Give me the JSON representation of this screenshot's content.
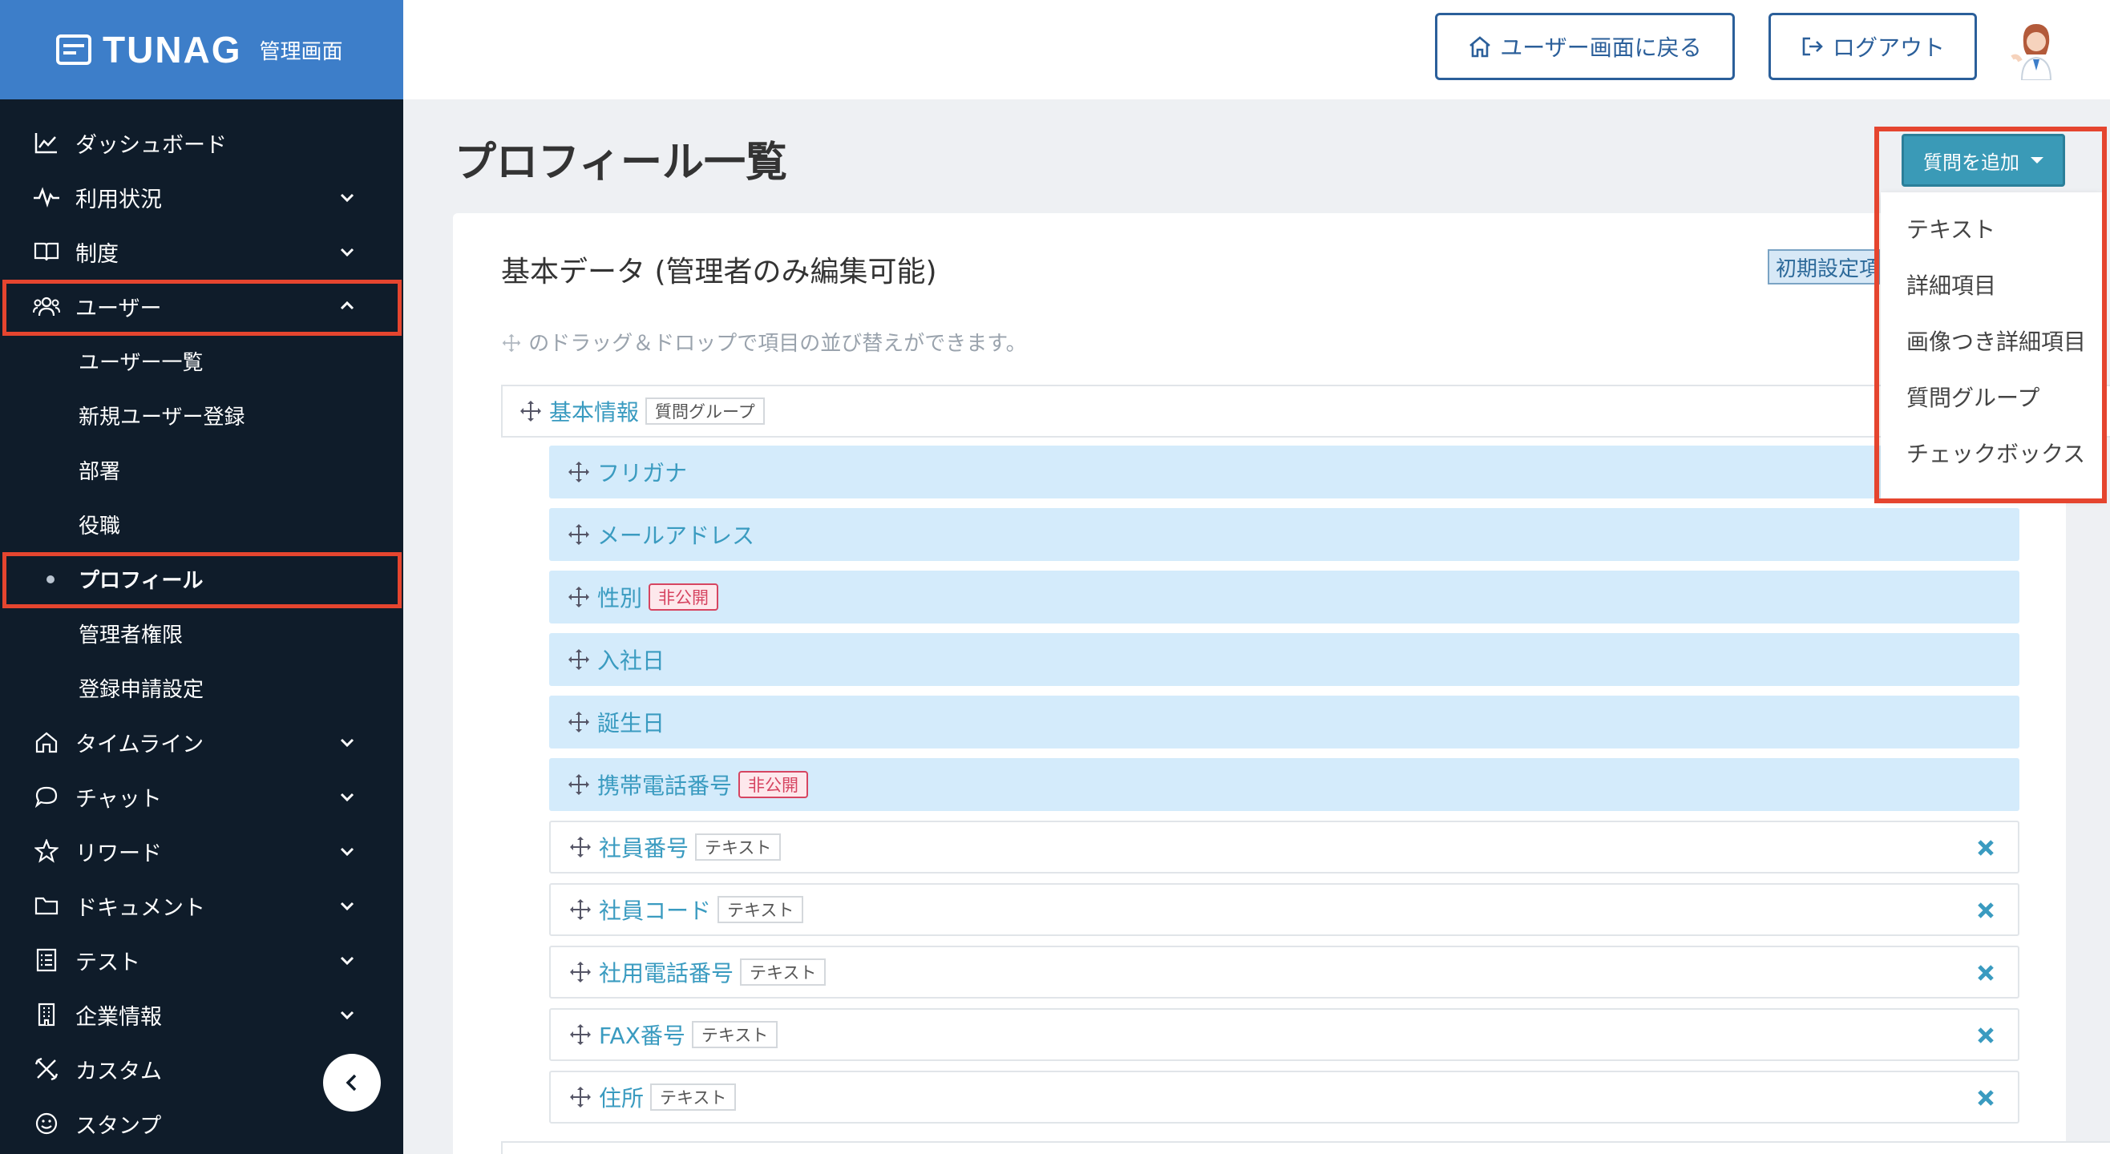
{
  "brand": {
    "logo": "TUNAG",
    "subtitle": "管理画面"
  },
  "sidebar": {
    "items": [
      {
        "label": "ダッシュボード",
        "icon": "chart-icon"
      },
      {
        "label": "利用状況",
        "icon": "pulse-icon"
      },
      {
        "label": "制度",
        "icon": "book-icon"
      },
      {
        "label": "ユーザー",
        "icon": "users-icon"
      },
      {
        "label": "タイムライン",
        "icon": "home-icon"
      },
      {
        "label": "チャット",
        "icon": "chat-icon"
      },
      {
        "label": "リワード",
        "icon": "star-icon"
      },
      {
        "label": "ドキュメント",
        "icon": "folder-icon"
      },
      {
        "label": "テスト",
        "icon": "checklist-icon"
      },
      {
        "label": "企業情報",
        "icon": "building-icon"
      },
      {
        "label": "カスタム",
        "icon": "tools-icon"
      },
      {
        "label": "スタンプ",
        "icon": "smile-icon"
      }
    ],
    "sub_items": [
      {
        "label": "ユーザー一覧"
      },
      {
        "label": "新規ユーザー登録"
      },
      {
        "label": "部署"
      },
      {
        "label": "役職"
      },
      {
        "label": "プロフィール"
      },
      {
        "label": "管理者権限"
      },
      {
        "label": "登録申請設定"
      }
    ]
  },
  "header": {
    "back_label": "ユーザー画面に戻る",
    "logout_label": "ログアウト"
  },
  "page": {
    "title": "プロフィール一覧",
    "card_title": "基本データ (管理者のみ編集可能)",
    "init_badge": "初期設定項目",
    "hint": "のドラッグ＆ドロップで項目の並び替えができます。"
  },
  "group": {
    "label": "基本情報",
    "tag": "質問グループ"
  },
  "items": [
    {
      "label": "フリガナ",
      "tag": ""
    },
    {
      "label": "メールアドレス",
      "tag": ""
    },
    {
      "label": "性別",
      "tag": "非公開"
    },
    {
      "label": "入社日",
      "tag": ""
    },
    {
      "label": "誕生日",
      "tag": ""
    },
    {
      "label": "携帯電話番号",
      "tag": "非公開"
    },
    {
      "label": "社員番号",
      "tag": "テキスト"
    },
    {
      "label": "社員コード",
      "tag": "テキスト"
    },
    {
      "label": "社用電話番号",
      "tag": "テキスト"
    },
    {
      "label": "FAX番号",
      "tag": "テキスト"
    },
    {
      "label": "住所",
      "tag": "テキスト"
    }
  ],
  "add_menu": {
    "button_label": "質問を追加",
    "options": [
      "テキスト",
      "詳細項目",
      "画像つき詳細項目",
      "質問グループ",
      "チェックボックス"
    ]
  },
  "colors": {
    "sidebar": "#0f1c2a",
    "brand": "#3d7ec9",
    "accent": "#3a9bc0",
    "highlight": "#e5452f"
  }
}
